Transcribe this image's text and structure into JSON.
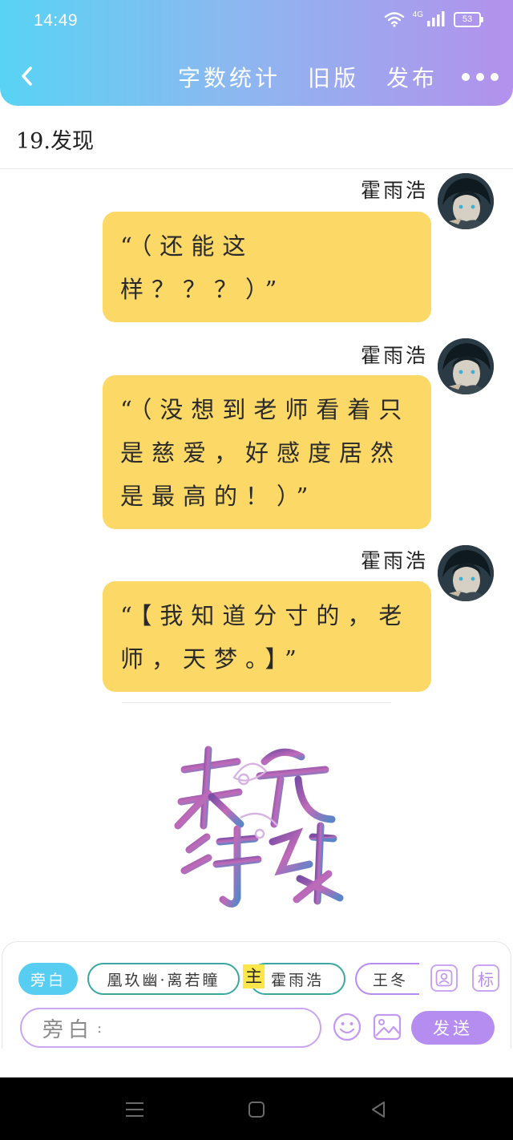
{
  "status_bar": {
    "time": "14:49",
    "network": "4G",
    "battery": "53"
  },
  "header": {
    "word_count_label": "字数统计",
    "old_version_label": "旧版",
    "publish_label": "发布"
  },
  "chapter": {
    "title": "19.发现"
  },
  "messages": [
    {
      "speaker": "霍雨浩",
      "text": "“（还能这样？？？）”"
    },
    {
      "speaker": "霍雨浩",
      "text": "“（没想到老师看着只是慈爱，好感度居然是最高的！）”"
    },
    {
      "speaker": "霍雨浩",
      "text": "“【我知道分寸的，老师，天梦。】”"
    }
  ],
  "composer": {
    "characters": [
      {
        "label": "旁白",
        "active": true
      },
      {
        "label": "凰玖幽·离若瞳"
      },
      {
        "label": "霍雨浩",
        "tag": "主"
      },
      {
        "label": "王冬"
      }
    ],
    "tag_button_label": "标",
    "input_placeholder_role": "旁白",
    "input_placeholder_colon": ":",
    "send_label": "发送"
  },
  "colors": {
    "header_gradient_start": "#58d3f4",
    "header_gradient_end": "#b391ec",
    "bubble": "#fcd967",
    "accent_purple": "#b58cf0",
    "accent_blue": "#56cdf1",
    "accent_teal": "#3aa7a0",
    "main_tag": "#fde64b"
  },
  "icons": {
    "back": "chevron-left-icon",
    "more": "more-dots-icon",
    "emoji": "smiley-icon",
    "image": "image-icon",
    "role": "user-card-icon"
  }
}
